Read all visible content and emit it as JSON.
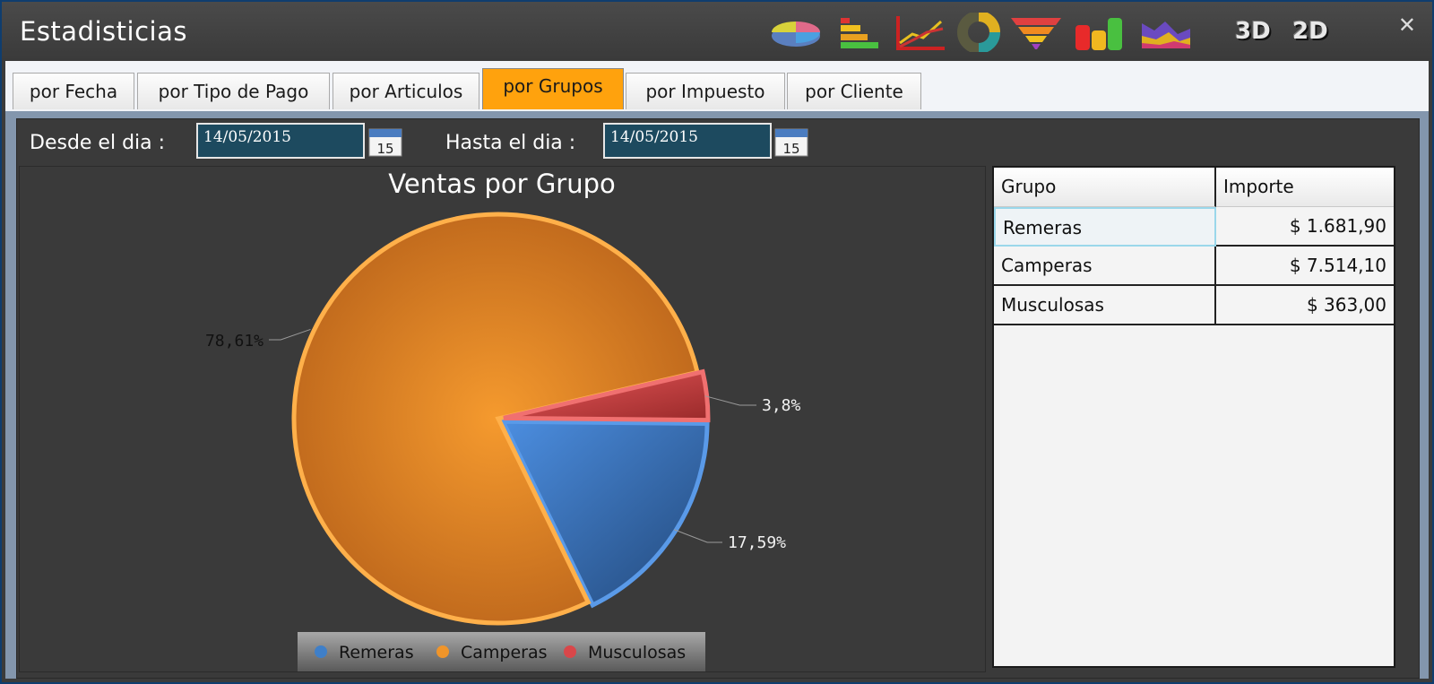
{
  "window": {
    "title": "Estadisticias",
    "close_glyph": "✕",
    "toolbar": {
      "icons": [
        "pie-chart-icon",
        "bar-chart-icon",
        "line-chart-icon",
        "doughnut-chart-icon",
        "funnel-chart-icon",
        "column-chart-icon",
        "area-chart-icon"
      ],
      "label_3d": "3D",
      "label_2d": "2D"
    }
  },
  "tabs": [
    {
      "label": "por Fecha",
      "active": false
    },
    {
      "label": "por Tipo de Pago",
      "active": false
    },
    {
      "label": "por Articulos",
      "active": false
    },
    {
      "label": "por Grupos",
      "active": true
    },
    {
      "label": "por Impuesto",
      "active": false
    },
    {
      "label": "por Cliente",
      "active": false
    }
  ],
  "filters": {
    "from_label": "Desde el dia :",
    "from_value": "14/05/2015",
    "to_label": "Hasta el dia :",
    "to_value": "14/05/2015",
    "calendar_day": "15"
  },
  "chart_data": {
    "type": "pie",
    "title": "Ventas por Grupo",
    "legend_position": "bottom",
    "slices": [
      {
        "name": "Remeras",
        "value": 1681.9,
        "percent_label": "17,59%",
        "color": "#3f7fc8"
      },
      {
        "name": "Camperas",
        "value": 7514.1,
        "percent_label": "78,61%",
        "color": "#f0952a"
      },
      {
        "name": "Musculosas",
        "value": 363.0,
        "percent_label": "3,8%",
        "color": "#d9474a"
      }
    ]
  },
  "grid": {
    "columns": [
      "Grupo",
      "Importe"
    ],
    "rows": [
      [
        "Remeras",
        "$ 1.681,90"
      ],
      [
        "Camperas",
        "$ 7.514,10"
      ],
      [
        "Musculosas",
        "$ 363,00"
      ]
    ]
  }
}
